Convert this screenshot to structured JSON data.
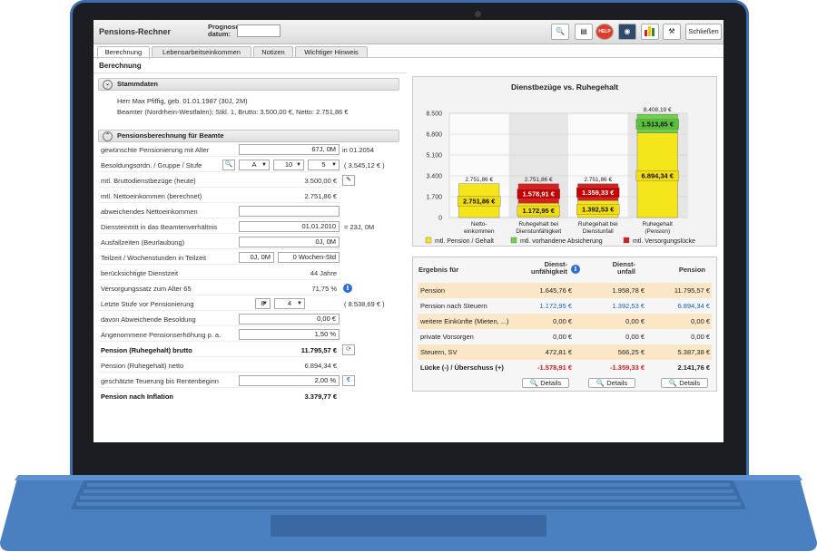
{
  "app": {
    "title": "Pensions-Rechner",
    "prognose_label": "Prognose-datum:",
    "prognose_value": "",
    "close_label": "Schließen",
    "toolbar_icons": [
      "magnifier-icon",
      "document-icon",
      "help-icon",
      "globe-icon",
      "bar-chart-icon",
      "tools-icon"
    ],
    "help_label": "HELP"
  },
  "tabs": [
    "Berechnung",
    "Lebensarbeitseinkommen",
    "Notizen",
    "Wichtiger Hinweis"
  ],
  "section_title": "Berechnung",
  "stammdaten": {
    "header": "Stammdaten",
    "line1": "Herr Max Pfiffig, geb. 01.01.1987 (30J, 2M)",
    "line2": "Beamter (Nordrhein-Westfalen); Stkl. 1, Brutto: 3.500,00 €, Netto: 2.751,86 €"
  },
  "beamte": {
    "header": "Pensionsberechnung für Beamte",
    "rows": {
      "pensionierung_label": "gewünschte Pensionierung mit Alter",
      "pensionierung_value": "67J, 0M",
      "pensionierung_suffix": "in 01.2054",
      "besoldung_label": "Besoldungsordn. / Gruppe / Stufe",
      "besoldung_ordn": "A",
      "besoldung_gruppe": "10",
      "besoldung_stufe": "5",
      "besoldung_suffix": "( 3.545,12 € )",
      "brutto_label": "mtl. Bruttodienstbezüge (heute)",
      "brutto_value": "3.500,00 €",
      "netto_label": "mtl. Nettoeinkommen (berechnet)",
      "netto_value": "2.751,86 €",
      "abw_netto_label": "abweichendes Nettoeinkommen",
      "abw_netto_value": "",
      "dienst_label": "Diensteintritt in das Beamtenverhältnis",
      "dienst_value": "01.01.2010",
      "dienst_suffix": "= 23J, 0M",
      "ausfall_label": "Ausfallzeiten (Beurlaubung)",
      "ausfall_value": "0J, 0M",
      "teilzeit_label": "Teilzeit / Wochenstunden in Teilzeit",
      "teilzeit_value1": "0J, 0M",
      "teilzeit_value2": "0 Wochen-Std",
      "beruecksichtigt_label": "berücksichtigte Dienstzeit",
      "beruecksichtigt_value": "44 Jahre",
      "versorgung_label": "Versorgungssatz zum Alter 65",
      "versorgung_value": "71,75 %",
      "letzte_label": "Letzte Stufe vor Pensionierung",
      "letzte_stufe1": "8",
      "letzte_stufe2": "4",
      "letzte_suffix": "( 8.538,69 € )",
      "abw_besold_label": "davon Abweichende Besoldung",
      "abw_besold_value": "0,00 €",
      "erhoehung_label": "Angenommene Pensionserhöhung p. a.",
      "erhoehung_value": "1,50 %",
      "pension_brutto_label": "Pension (Ruhegehalt) brutto",
      "pension_brutto_value": "11.795,57 €",
      "pension_netto_label": "Pension (Ruhegehalt) netto",
      "pension_netto_value": "6.894,34 €",
      "teuerung_label": "geschätzte Teuerung bis Rentenbeginn",
      "teuerung_value": "2,00 %",
      "inflation_label": "Pension nach Inflation",
      "inflation_value": "3.379,77 €"
    }
  },
  "chart_data": {
    "type": "bar",
    "title": "Dienstbezüge vs. Ruhegehalt",
    "categories": [
      "Netto-einkommen",
      "Ruhegehalt bei Dienstunfähigkeit",
      "Ruhegehalt bei Dienstunfall",
      "Ruhegehalt (Pension)"
    ],
    "ylim": [
      0,
      8500
    ],
    "yticks": [
      0,
      1700,
      3400,
      5100,
      6800,
      8500
    ],
    "ytick_labels": [
      "0",
      "1.700",
      "3.400",
      "5.100",
      "6.800",
      "8.500"
    ],
    "totals": [
      2751.86,
      2751.86,
      2751.86,
      8408.19
    ],
    "total_labels": [
      "2.751,86 €",
      "2.751,86 €",
      "2.751,86 €",
      "8.408,19 €"
    ],
    "series": [
      {
        "name": "mtl. Pension / Gehalt",
        "color": "#f5e51b",
        "values": [
          2751.86,
          1172.95,
          1392.53,
          6894.34
        ],
        "labels": [
          "2.751,86 €",
          "1.172,95 €",
          "1.392,53 €",
          "6.894,34 €"
        ]
      },
      {
        "name": "mtl. vorhandene Absicherung",
        "color": "#6fd04b",
        "values": [
          0,
          0,
          0,
          1513.85
        ],
        "labels": [
          "",
          "",
          "",
          "1.513,85 €"
        ]
      },
      {
        "name": "mtl. Versorgungslücke",
        "color": "#d81f1f",
        "values": [
          0,
          1578.91,
          1359.33,
          0
        ],
        "labels": [
          "",
          "1.578,91 €",
          "1.359,33 €",
          ""
        ]
      }
    ],
    "grid": true,
    "legend": "bottom"
  },
  "ergebnis": {
    "header": "Ergebnis für",
    "columns": [
      "Dienst-unfähigkeit",
      "Dienst-unfall",
      "Pension"
    ],
    "rows": [
      {
        "label": "Pension",
        "values": [
          "1.645,76 €",
          "1.958,78 €",
          "11.795,57 €"
        ],
        "style": ""
      },
      {
        "label": "Pension nach Steuern",
        "values": [
          "1.172,95 €",
          "1.392,53 €",
          "6.894,34 €"
        ],
        "style": "blue"
      },
      {
        "label": "weitere Einkünfte (Mieten, ...)",
        "values": [
          "0,00 €",
          "0,00 €",
          "0,00 €"
        ],
        "style": ""
      },
      {
        "label": "private Vorsorgen",
        "values": [
          "0,00 €",
          "0,00 €",
          "0,00 €"
        ],
        "style": ""
      },
      {
        "label": "Steuern, SV",
        "values": [
          "472,81 €",
          "566,25 €",
          "5.387,38 €"
        ],
        "style": ""
      },
      {
        "label": "Lücke (-) / Überschuss (+)",
        "values": [
          "-1.578,91 €",
          "-1.359,33 €",
          "2.141,76 €"
        ],
        "style": "bold"
      }
    ],
    "details_label": "Details"
  }
}
